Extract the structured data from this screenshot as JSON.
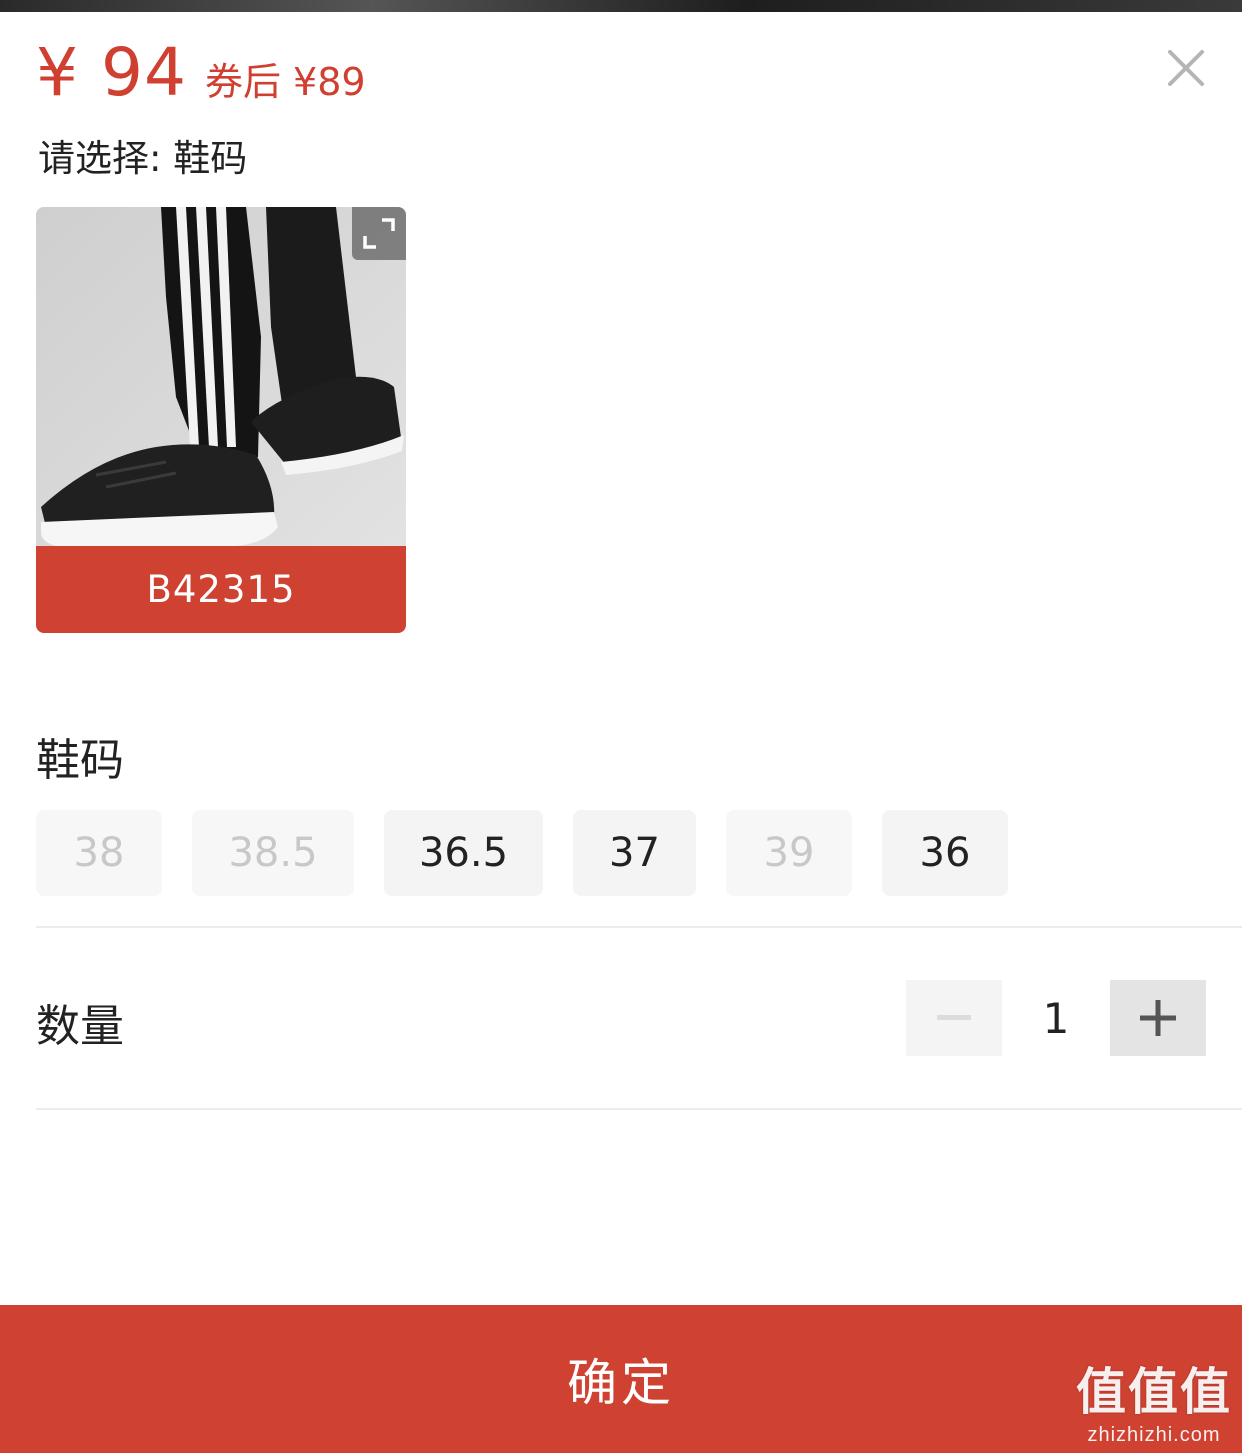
{
  "header": {
    "price": "¥ 94",
    "coupon_price": "券后 ¥89",
    "close_icon": "close-icon",
    "select_hint": "请选择: 鞋码"
  },
  "sku": {
    "image_alt": "sneaker product photo",
    "expand_icon": "expand-icon",
    "code": "B42315"
  },
  "size_section": {
    "title": "鞋码",
    "options": [
      {
        "label": "38",
        "available": false
      },
      {
        "label": "38.5",
        "available": false
      },
      {
        "label": "36.5",
        "available": true
      },
      {
        "label": "37",
        "available": true
      },
      {
        "label": "39",
        "available": false
      },
      {
        "label": "36",
        "available": true
      }
    ]
  },
  "quantity": {
    "title": "数量",
    "value": "1",
    "minus_icon": "minus-icon",
    "plus_icon": "plus-icon"
  },
  "footer": {
    "confirm_label": "确定"
  },
  "watermark": {
    "logo": "值值值",
    "url": "zhizhizhi.com"
  },
  "colors": {
    "accent": "#cf4232",
    "price": "#d04030",
    "chip_bg": "#f4f4f4",
    "disabled_text": "#c8c8c8"
  }
}
